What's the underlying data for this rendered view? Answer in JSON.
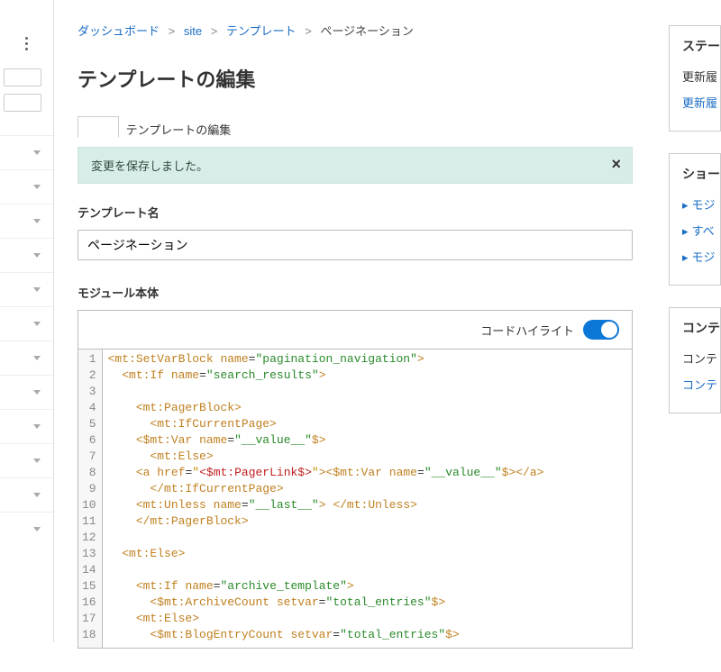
{
  "breadcrumb": {
    "items": [
      "ダッシュボード",
      "site",
      "テンプレート"
    ],
    "current": "ページネーション"
  },
  "title": "テンプレートの編集",
  "tab_label": "テンプレートの編集",
  "flash": {
    "message": "変更を保存しました。"
  },
  "template_name": {
    "label": "テンプレート名",
    "value": "ページネーション"
  },
  "module_body_label": "モジュール本体",
  "code_highlight_label": "コードハイライト",
  "code_highlight_on": true,
  "code_lines": [
    [
      [
        "tg",
        "<mt:SetVarBlock"
      ],
      [
        "",
        " "
      ],
      [
        "an",
        "name"
      ],
      [
        "",
        "="
      ],
      [
        "av",
        "\"pagination_navigation\""
      ],
      [
        "tg",
        ">"
      ]
    ],
    [
      [
        "",
        "  "
      ],
      [
        "tg",
        "<mt:If"
      ],
      [
        "",
        " "
      ],
      [
        "an",
        "name"
      ],
      [
        "",
        "="
      ],
      [
        "av",
        "\"search_results\""
      ],
      [
        "tg",
        ">"
      ]
    ],
    [],
    [
      [
        "",
        "    "
      ],
      [
        "tg",
        "<mt:PagerBlock>"
      ]
    ],
    [
      [
        "",
        "      "
      ],
      [
        "tg",
        "<mt:IfCurrentPage>"
      ]
    ],
    [
      [
        "",
        "    "
      ],
      [
        "tg",
        "<$mt:Var"
      ],
      [
        "",
        " "
      ],
      [
        "an",
        "name"
      ],
      [
        "",
        "="
      ],
      [
        "av",
        "\"__value__\""
      ],
      [
        "tg",
        "$>"
      ]
    ],
    [
      [
        "",
        "      "
      ],
      [
        "tg",
        "<mt:Else>"
      ]
    ],
    [
      [
        "",
        "    "
      ],
      [
        "tg",
        "<a"
      ],
      [
        "",
        " "
      ],
      [
        "an",
        "href"
      ],
      [
        "",
        "="
      ],
      [
        "avq",
        "\""
      ],
      [
        "inner",
        "<$mt:PagerLink$>"
      ],
      [
        "avq",
        "\""
      ],
      [
        "tg",
        ">"
      ],
      [
        "tg",
        "<$mt:Var"
      ],
      [
        "",
        " "
      ],
      [
        "an",
        "name"
      ],
      [
        "",
        "="
      ],
      [
        "av",
        "\"__value__\""
      ],
      [
        "tg",
        "$>"
      ],
      [
        "tg",
        "</a>"
      ]
    ],
    [
      [
        "",
        "      "
      ],
      [
        "tg",
        "</mt:IfCurrentPage>"
      ]
    ],
    [
      [
        "",
        "    "
      ],
      [
        "tg",
        "<mt:Unless"
      ],
      [
        "",
        " "
      ],
      [
        "an",
        "name"
      ],
      [
        "",
        "="
      ],
      [
        "av",
        "\"__last__\""
      ],
      [
        "tg",
        ">"
      ],
      [
        "",
        " "
      ],
      [
        "tg",
        "</mt:Unless>"
      ]
    ],
    [
      [
        "",
        "    "
      ],
      [
        "tg",
        "</mt:PagerBlock>"
      ]
    ],
    [],
    [
      [
        "",
        "  "
      ],
      [
        "tg",
        "<mt:Else>"
      ]
    ],
    [],
    [
      [
        "",
        "    "
      ],
      [
        "tg",
        "<mt:If"
      ],
      [
        "",
        " "
      ],
      [
        "an",
        "name"
      ],
      [
        "",
        "="
      ],
      [
        "av",
        "\"archive_template\""
      ],
      [
        "tg",
        ">"
      ]
    ],
    [
      [
        "",
        "      "
      ],
      [
        "tg",
        "<$mt:ArchiveCount"
      ],
      [
        "",
        " "
      ],
      [
        "an",
        "setvar"
      ],
      [
        "",
        "="
      ],
      [
        "av",
        "\"total_entries\""
      ],
      [
        "tg",
        "$>"
      ]
    ],
    [
      [
        "",
        "    "
      ],
      [
        "tg",
        "<mt:Else>"
      ]
    ],
    [
      [
        "",
        "      "
      ],
      [
        "tg",
        "<$mt:BlogEntryCount"
      ],
      [
        "",
        " "
      ],
      [
        "an",
        "setvar"
      ],
      [
        "",
        "="
      ],
      [
        "av",
        "\"total_entries\""
      ],
      [
        "tg",
        "$>"
      ]
    ]
  ],
  "right_panels": {
    "status": {
      "title": "ステー",
      "items": [
        {
          "text": "更新履",
          "link": false
        },
        {
          "text": "更新履",
          "link": true
        }
      ]
    },
    "shortcut": {
      "title": "ショー",
      "items": [
        {
          "text": "モジ",
          "arrow": true,
          "link": true
        },
        {
          "text": "すべ",
          "arrow": true,
          "link": true
        },
        {
          "text": "モジ",
          "arrow": true,
          "link": true
        }
      ]
    },
    "content": {
      "title": "コンテ",
      "items": [
        {
          "text": "コンテ",
          "link": false
        },
        {
          "text": "コンテ",
          "link": true
        }
      ]
    }
  }
}
